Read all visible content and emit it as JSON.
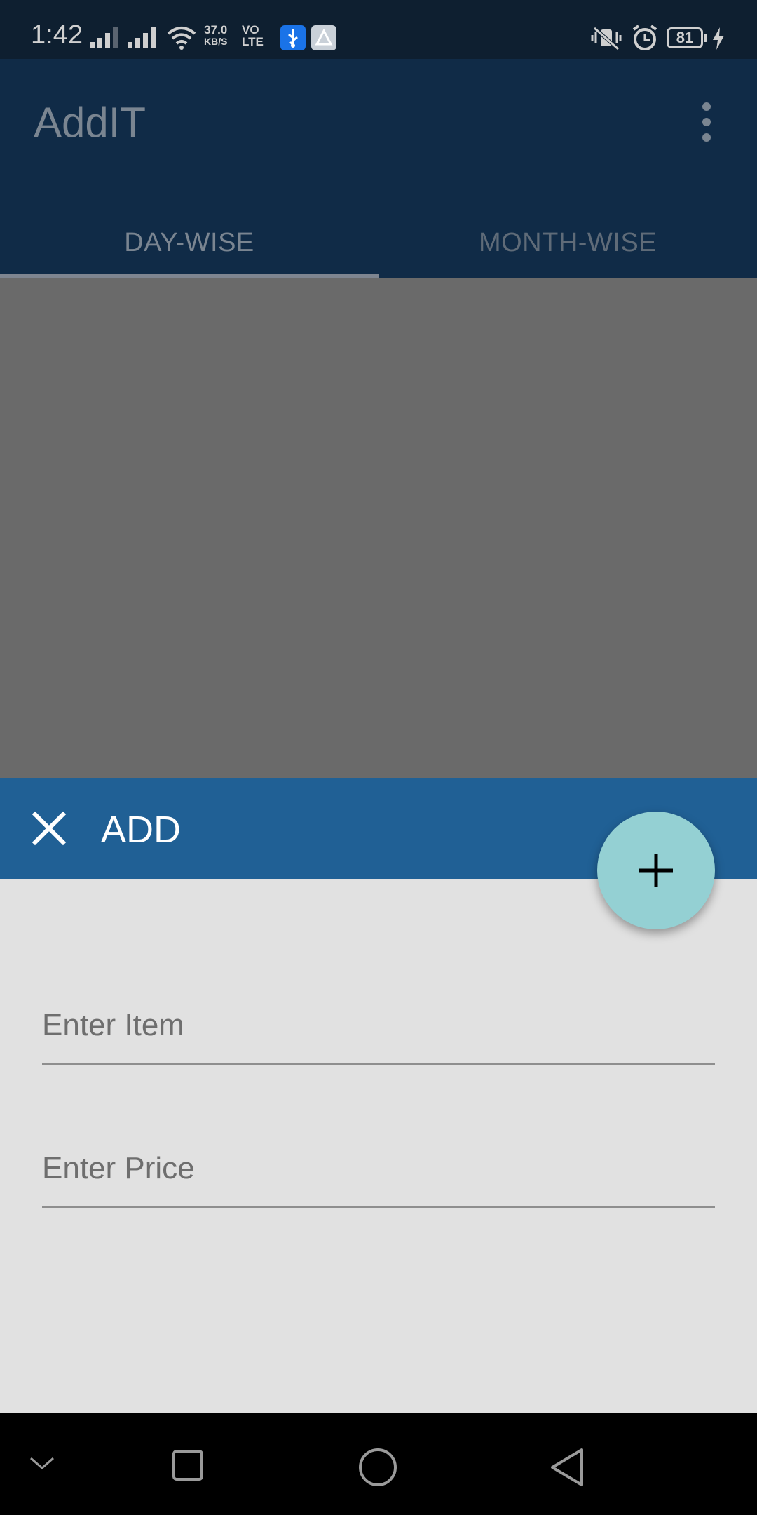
{
  "status_bar": {
    "time": "1:42",
    "net_speed_value": "37.0",
    "net_speed_unit": "KB/S",
    "volte_top": "VO",
    "volte_bottom": "LTE",
    "battery_level": "81",
    "icons": [
      "signal-icon",
      "signal-icon",
      "wifi-icon",
      "usb-icon",
      "app-notification-icon",
      "vibrate-icon",
      "alarm-icon",
      "battery-icon",
      "charging-icon"
    ]
  },
  "app_bar": {
    "title": "AddIT",
    "tabs": [
      {
        "label": "DAY-WISE",
        "selected": true
      },
      {
        "label": "MONTH-WISE",
        "selected": false
      }
    ]
  },
  "sheet": {
    "title": "ADD",
    "item_placeholder": "Enter Item",
    "price_placeholder": "Enter Price"
  },
  "colors": {
    "app_bar": "#102b47",
    "sheet_header": "#206095",
    "fab": "#94d0d3",
    "sheet_body": "#e1e1e1",
    "scrim": "#6a6a6a"
  }
}
